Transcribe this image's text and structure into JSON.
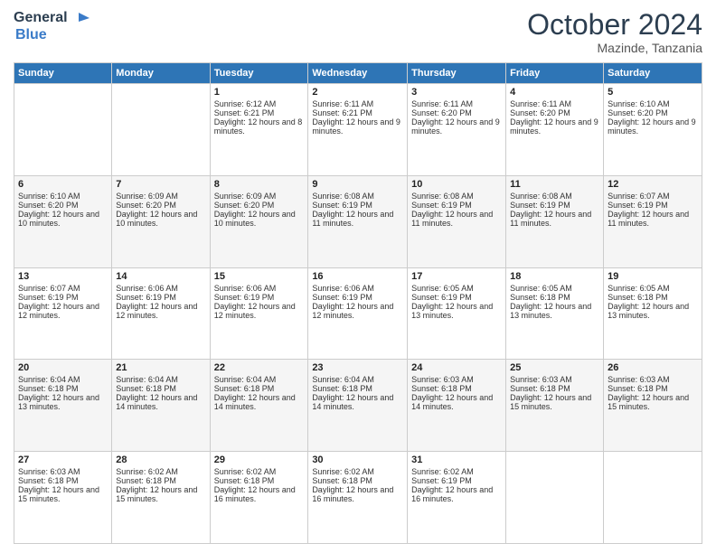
{
  "header": {
    "logo_line1": "General",
    "logo_line2": "Blue",
    "month": "October 2024",
    "location": "Mazinde, Tanzania"
  },
  "days_of_week": [
    "Sunday",
    "Monday",
    "Tuesday",
    "Wednesday",
    "Thursday",
    "Friday",
    "Saturday"
  ],
  "weeks": [
    [
      {
        "day": "",
        "info": ""
      },
      {
        "day": "",
        "info": ""
      },
      {
        "day": "1",
        "info": "Sunrise: 6:12 AM\nSunset: 6:21 PM\nDaylight: 12 hours and 8 minutes."
      },
      {
        "day": "2",
        "info": "Sunrise: 6:11 AM\nSunset: 6:21 PM\nDaylight: 12 hours and 9 minutes."
      },
      {
        "day": "3",
        "info": "Sunrise: 6:11 AM\nSunset: 6:20 PM\nDaylight: 12 hours and 9 minutes."
      },
      {
        "day": "4",
        "info": "Sunrise: 6:11 AM\nSunset: 6:20 PM\nDaylight: 12 hours and 9 minutes."
      },
      {
        "day": "5",
        "info": "Sunrise: 6:10 AM\nSunset: 6:20 PM\nDaylight: 12 hours and 9 minutes."
      }
    ],
    [
      {
        "day": "6",
        "info": "Sunrise: 6:10 AM\nSunset: 6:20 PM\nDaylight: 12 hours and 10 minutes."
      },
      {
        "day": "7",
        "info": "Sunrise: 6:09 AM\nSunset: 6:20 PM\nDaylight: 12 hours and 10 minutes."
      },
      {
        "day": "8",
        "info": "Sunrise: 6:09 AM\nSunset: 6:20 PM\nDaylight: 12 hours and 10 minutes."
      },
      {
        "day": "9",
        "info": "Sunrise: 6:08 AM\nSunset: 6:19 PM\nDaylight: 12 hours and 11 minutes."
      },
      {
        "day": "10",
        "info": "Sunrise: 6:08 AM\nSunset: 6:19 PM\nDaylight: 12 hours and 11 minutes."
      },
      {
        "day": "11",
        "info": "Sunrise: 6:08 AM\nSunset: 6:19 PM\nDaylight: 12 hours and 11 minutes."
      },
      {
        "day": "12",
        "info": "Sunrise: 6:07 AM\nSunset: 6:19 PM\nDaylight: 12 hours and 11 minutes."
      }
    ],
    [
      {
        "day": "13",
        "info": "Sunrise: 6:07 AM\nSunset: 6:19 PM\nDaylight: 12 hours and 12 minutes."
      },
      {
        "day": "14",
        "info": "Sunrise: 6:06 AM\nSunset: 6:19 PM\nDaylight: 12 hours and 12 minutes."
      },
      {
        "day": "15",
        "info": "Sunrise: 6:06 AM\nSunset: 6:19 PM\nDaylight: 12 hours and 12 minutes."
      },
      {
        "day": "16",
        "info": "Sunrise: 6:06 AM\nSunset: 6:19 PM\nDaylight: 12 hours and 12 minutes."
      },
      {
        "day": "17",
        "info": "Sunrise: 6:05 AM\nSunset: 6:19 PM\nDaylight: 12 hours and 13 minutes."
      },
      {
        "day": "18",
        "info": "Sunrise: 6:05 AM\nSunset: 6:18 PM\nDaylight: 12 hours and 13 minutes."
      },
      {
        "day": "19",
        "info": "Sunrise: 6:05 AM\nSunset: 6:18 PM\nDaylight: 12 hours and 13 minutes."
      }
    ],
    [
      {
        "day": "20",
        "info": "Sunrise: 6:04 AM\nSunset: 6:18 PM\nDaylight: 12 hours and 13 minutes."
      },
      {
        "day": "21",
        "info": "Sunrise: 6:04 AM\nSunset: 6:18 PM\nDaylight: 12 hours and 14 minutes."
      },
      {
        "day": "22",
        "info": "Sunrise: 6:04 AM\nSunset: 6:18 PM\nDaylight: 12 hours and 14 minutes."
      },
      {
        "day": "23",
        "info": "Sunrise: 6:04 AM\nSunset: 6:18 PM\nDaylight: 12 hours and 14 minutes."
      },
      {
        "day": "24",
        "info": "Sunrise: 6:03 AM\nSunset: 6:18 PM\nDaylight: 12 hours and 14 minutes."
      },
      {
        "day": "25",
        "info": "Sunrise: 6:03 AM\nSunset: 6:18 PM\nDaylight: 12 hours and 15 minutes."
      },
      {
        "day": "26",
        "info": "Sunrise: 6:03 AM\nSunset: 6:18 PM\nDaylight: 12 hours and 15 minutes."
      }
    ],
    [
      {
        "day": "27",
        "info": "Sunrise: 6:03 AM\nSunset: 6:18 PM\nDaylight: 12 hours and 15 minutes."
      },
      {
        "day": "28",
        "info": "Sunrise: 6:02 AM\nSunset: 6:18 PM\nDaylight: 12 hours and 15 minutes."
      },
      {
        "day": "29",
        "info": "Sunrise: 6:02 AM\nSunset: 6:18 PM\nDaylight: 12 hours and 16 minutes."
      },
      {
        "day": "30",
        "info": "Sunrise: 6:02 AM\nSunset: 6:18 PM\nDaylight: 12 hours and 16 minutes."
      },
      {
        "day": "31",
        "info": "Sunrise: 6:02 AM\nSunset: 6:19 PM\nDaylight: 12 hours and 16 minutes."
      },
      {
        "day": "",
        "info": ""
      },
      {
        "day": "",
        "info": ""
      }
    ]
  ]
}
